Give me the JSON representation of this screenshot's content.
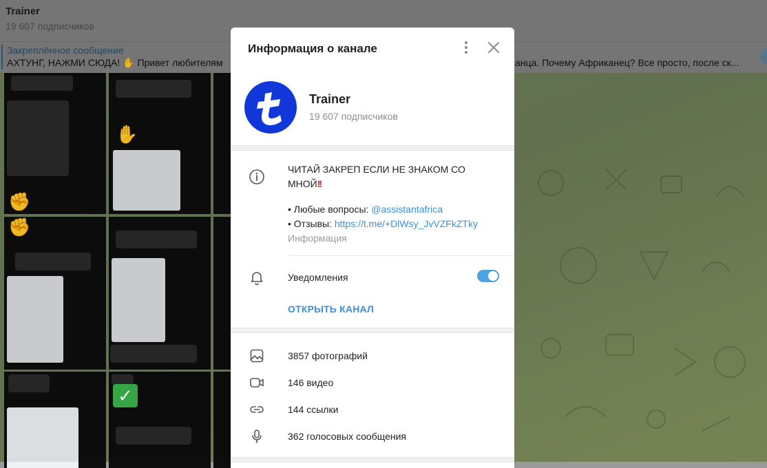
{
  "header": {
    "title": "Trainer",
    "subtitle": "19 607 подписчиков"
  },
  "pinned": {
    "label": "Закреплённое сообщение",
    "text": "АХТУНГ, НАЖМИ СЮДА!",
    "text_tail": "Привет любителям",
    "text_right": "анца.  Почему Африканец? Все просто, после ск..."
  },
  "modal": {
    "title": "Информация о канале",
    "channel_name": "Trainer",
    "channel_subs": "19 607 подписчиков",
    "description_line1": "ЧИТАЙ ЗАКРЕП ЕСЛИ НЕ ЗНАКОМ СО МНОЙ",
    "description_bang": "!!",
    "questions_prefix": "• Любые вопросы: ",
    "questions_link": "@assistantafrica",
    "reviews_prefix": "• Отзывы: ",
    "reviews_link": "https://t.me/+DlWsy_JvVZFkZTky",
    "info_caption": "Информация",
    "notifications_label": "Уведомления",
    "notifications_on": true,
    "open_channel_label": "ОТКРЫТЬ КАНАЛ",
    "stats": [
      {
        "icon": "photo-icon",
        "label": "3857 фотографий"
      },
      {
        "icon": "video-icon",
        "label": "146 видео"
      },
      {
        "icon": "link-icon",
        "label": "144 ссылки"
      },
      {
        "icon": "mic-icon",
        "label": "362 голосовых сообщения"
      }
    ]
  },
  "colors": {
    "accent": "#3a8fd6",
    "avatar": "#1237d8",
    "toggle": "#4ea4e0"
  }
}
